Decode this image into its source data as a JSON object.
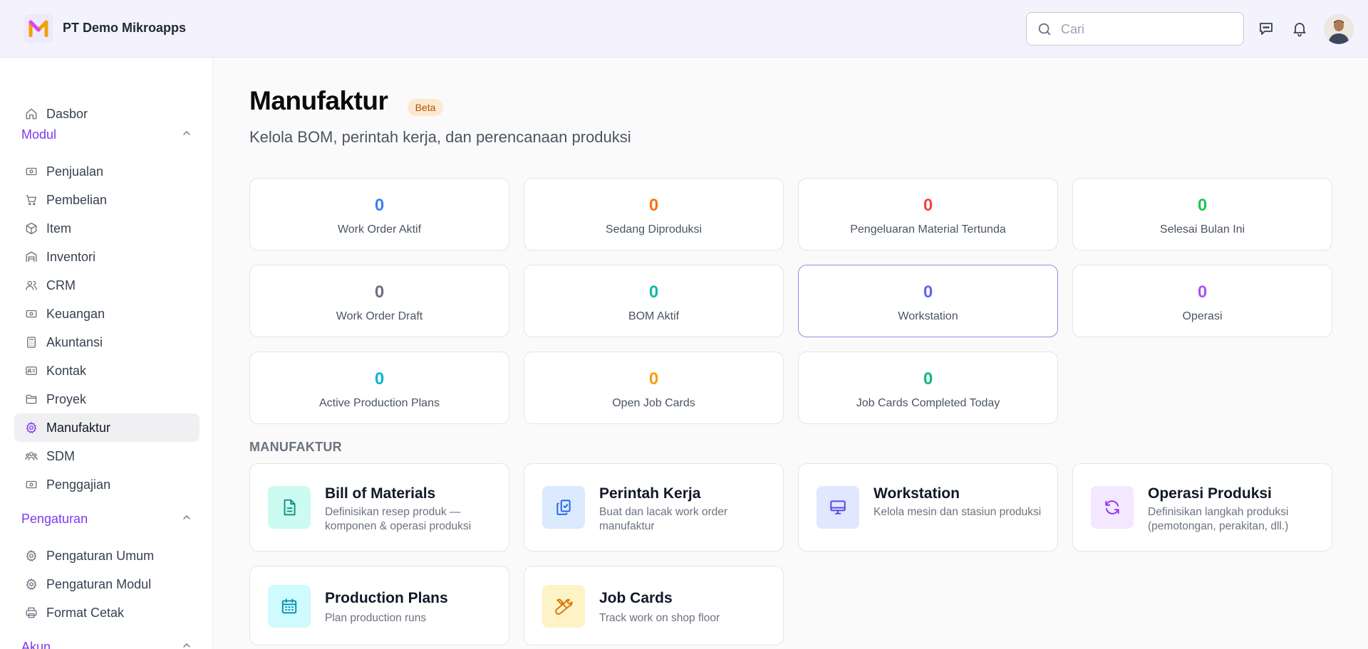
{
  "header": {
    "company": "PT Demo Mikroapps",
    "search_placeholder": "Cari"
  },
  "sidebar": {
    "top_items": [
      {
        "label": "Dasbor",
        "icon": "home-icon"
      }
    ],
    "modul": {
      "title": "Modul",
      "items": [
        {
          "label": "Penjualan",
          "icon": "banknote-icon"
        },
        {
          "label": "Pembelian",
          "icon": "cart-icon"
        },
        {
          "label": "Item",
          "icon": "box-icon"
        },
        {
          "label": "Inventori",
          "icon": "warehouse-icon"
        },
        {
          "label": "CRM",
          "icon": "users-icon"
        },
        {
          "label": "Keuangan",
          "icon": "banknote-icon"
        },
        {
          "label": "Akuntansi",
          "icon": "calculator-icon"
        },
        {
          "label": "Kontak",
          "icon": "contact-card-icon"
        },
        {
          "label": "Proyek",
          "icon": "folder-icon"
        },
        {
          "label": "Manufaktur",
          "icon": "gear-icon",
          "active": true
        },
        {
          "label": "SDM",
          "icon": "team-icon"
        },
        {
          "label": "Penggajian",
          "icon": "banknote-icon"
        }
      ]
    },
    "pengaturan": {
      "title": "Pengaturan",
      "items": [
        {
          "label": "Pengaturan Umum",
          "icon": "gear-icon"
        },
        {
          "label": "Pengaturan Modul",
          "icon": "gear-icon"
        },
        {
          "label": "Format Cetak",
          "icon": "printer-icon"
        }
      ]
    },
    "akun": {
      "title": "Akun"
    }
  },
  "main": {
    "title": "Manufaktur",
    "badge": "Beta",
    "subtitle": "Kelola BOM, perintah kerja, dan perencanaan produksi",
    "stats": [
      {
        "value": "0",
        "label": "Work Order Aktif",
        "color": "#3b82f6"
      },
      {
        "value": "0",
        "label": "Sedang Diproduksi",
        "color": "#f97316"
      },
      {
        "value": "0",
        "label": "Pengeluaran Material Tertunda",
        "color": "#ef4444"
      },
      {
        "value": "0",
        "label": "Selesai Bulan Ini",
        "color": "#22c55e"
      },
      {
        "value": "0",
        "label": "Work Order Draft",
        "color": "#6b7280"
      },
      {
        "value": "0",
        "label": "BOM Aktif",
        "color": "#14b8a6"
      },
      {
        "value": "0",
        "label": "Workstation",
        "color": "#6366f1"
      },
      {
        "value": "0",
        "label": "Operasi",
        "color": "#a855f7"
      },
      {
        "value": "0",
        "label": "Active Production Plans",
        "color": "#06b6d4"
      },
      {
        "value": "0",
        "label": "Open Job Cards",
        "color": "#f59e0b"
      },
      {
        "value": "0",
        "label": "Job Cards Completed Today",
        "color": "#10b981"
      }
    ],
    "group_label": "MANUFAKTUR",
    "cards": [
      {
        "title": "Bill of Materials",
        "desc": "Definisikan resep produk — komponen & operasi produksi",
        "icon": "document-icon",
        "bg": "#ccfbf1",
        "fg": "#0d9488"
      },
      {
        "title": "Perintah Kerja",
        "desc": "Buat dan lacak work order manufaktur",
        "icon": "clipboard-icon",
        "bg": "#dbeafe",
        "fg": "#2563eb"
      },
      {
        "title": "Workstation",
        "desc": "Kelola mesin dan stasiun produksi",
        "icon": "monitor-icon",
        "bg": "#e0e7ff",
        "fg": "#4f46e5"
      },
      {
        "title": "Operasi Produksi",
        "desc": "Definisikan langkah produksi (pemotongan, perakitan, dll.)",
        "icon": "refresh-icon",
        "bg": "#f3e8ff",
        "fg": "#9333ea"
      },
      {
        "title": "Production Plans",
        "desc": "Plan production runs",
        "icon": "calendar-icon",
        "bg": "#cffafe",
        "fg": "#0891b2"
      },
      {
        "title": "Job Cards",
        "desc": "Track work on shop floor",
        "icon": "tools-icon",
        "bg": "#fef3c7",
        "fg": "#d97706"
      }
    ]
  }
}
